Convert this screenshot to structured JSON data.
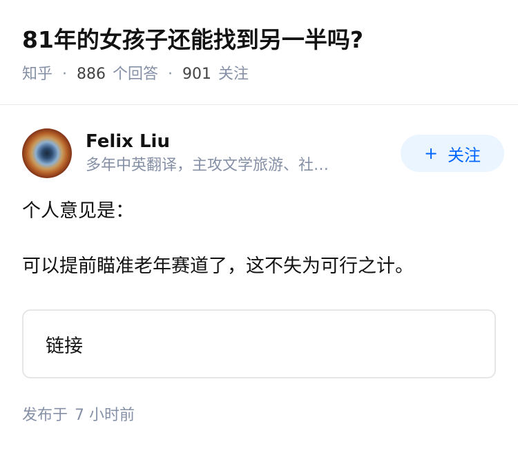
{
  "question": {
    "title": "81年的女孩子还能找到另一半吗?",
    "source": "知乎",
    "answers_count": "886",
    "answers_label": "个回答",
    "followers_count": "901",
    "followers_label": "关注"
  },
  "answer": {
    "author": {
      "name": "Felix Liu",
      "description": "多年中英翻译，主攻文学旅游、社…"
    },
    "follow_button": {
      "icon": "+",
      "label": "关注"
    },
    "paragraphs": [
      "个人意见是：",
      "可以提前瞄准老年赛道了，这不失为可行之计。"
    ],
    "link_card_label": "链接",
    "published_label": "发布于",
    "published_time": "7 小时前"
  },
  "colors": {
    "primary_text": "#121212",
    "secondary_text": "#8590a6",
    "accent_blue": "#0066ff",
    "follow_bg": "#ebf5ff"
  },
  "icons": {
    "follow": "plus-icon",
    "avatar": "avatar-image"
  }
}
